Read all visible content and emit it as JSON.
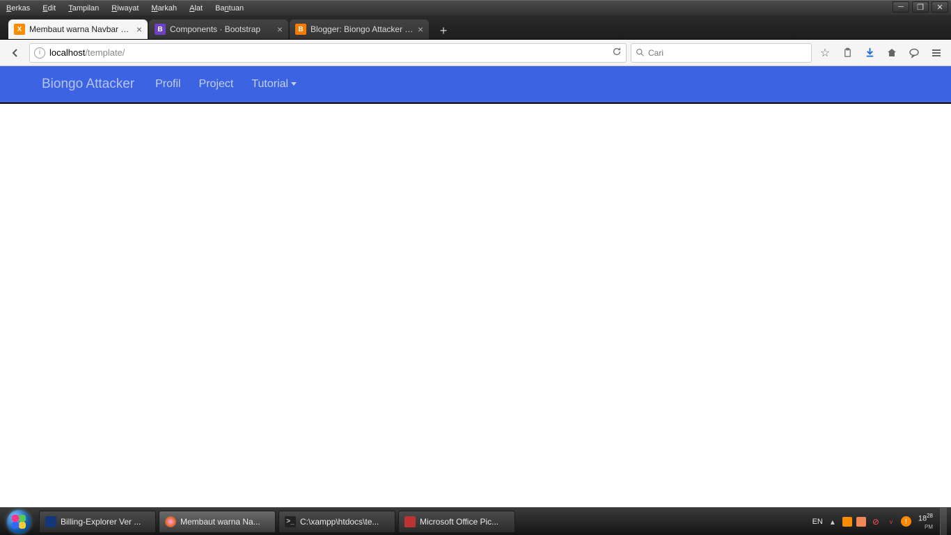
{
  "menubar": {
    "items": [
      "Berkas",
      "Edit",
      "Tampilan",
      "Riwayat",
      "Markah",
      "Alat",
      "Bantuan"
    ]
  },
  "tabs": [
    {
      "label": "Membaut warna Navbar me...",
      "favicon_bg": "#fb8c00",
      "favicon_txt": "X",
      "active": true
    },
    {
      "label": "Components · Bootstrap",
      "favicon_bg": "#6f42c1",
      "favicon_txt": "B",
      "active": false
    },
    {
      "label": "Blogger: Biongo Attacker - ...",
      "favicon_bg": "#f57c00",
      "favicon_txt": "B",
      "active": false
    }
  ],
  "url": {
    "host": "localhost",
    "path": "/template/"
  },
  "search": {
    "placeholder": "Cari"
  },
  "page_nav": {
    "brand": "Biongo Attacker",
    "links": [
      "Profil",
      "Project",
      "Tutorial"
    ]
  },
  "taskbar": {
    "buttons": [
      {
        "label": "Billing-Explorer Ver ...",
        "ico_bg": "#14367a",
        "ico_txt": ""
      },
      {
        "label": "Membaut warna Na...",
        "ico_bg": "#e06b1f",
        "ico_txt": "",
        "active": true
      },
      {
        "label": "C:\\xampp\\htdocs\\te...",
        "ico_bg": "#222",
        "ico_txt": ""
      },
      {
        "label": "Microsoft Office Pic...",
        "ico_bg": "#b33",
        "ico_txt": ""
      }
    ],
    "lang": "EN",
    "time": "18",
    "time_min": "28",
    "ampm": "PM"
  }
}
